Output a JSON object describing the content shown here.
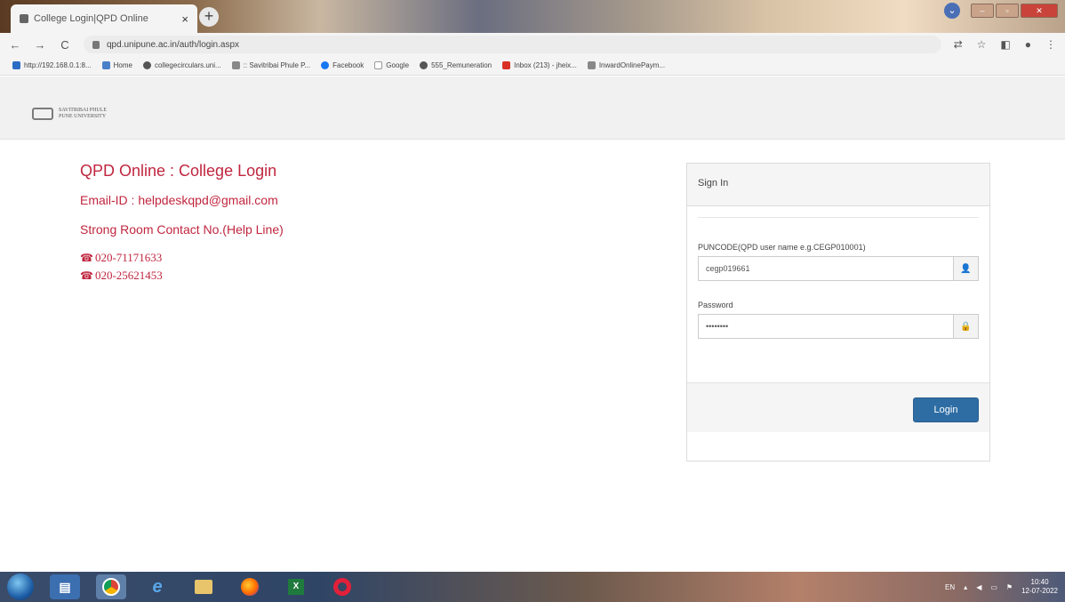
{
  "browser": {
    "tab_title": "College Login|QPD Online",
    "tab_close": "×",
    "new_tab": "+",
    "url": "qpd.unipune.ac.in/auth/login.aspx",
    "nav": {
      "back": "←",
      "forward": "→",
      "reload": "C"
    },
    "bookmarks": [
      {
        "label": "http://192.168.0.1:8...",
        "icon": "app-icon"
      },
      {
        "label": "Home",
        "icon": "home-icon"
      },
      {
        "label": "collegecirculars.uni...",
        "icon": "web-icon"
      },
      {
        "label": ":: Savitribai Phule P...",
        "icon": "university-icon"
      },
      {
        "label": "Facebook",
        "icon": "facebook-icon"
      },
      {
        "label": "Google",
        "icon": "google-icon"
      },
      {
        "label": "555_Remuneration",
        "icon": "web-icon"
      },
      {
        "label": "Inbox (213) - jheix...",
        "icon": "gmail-icon"
      },
      {
        "label": "InwardOnlinePaym...",
        "icon": "university-icon"
      }
    ]
  },
  "header": {
    "logo_line1": "SAVITRIBAI PHULE",
    "logo_line2": "PUNE UNIVERSITY"
  },
  "info": {
    "heading": "QPD Online : College Login",
    "email": "Email-ID : helpdeskqpd@gmail.com",
    "strong_room": "Strong Room Contact No.(Help Line)",
    "phones": [
      "020-71171633",
      "020-25621453"
    ]
  },
  "signin": {
    "title": "Sign In",
    "username_label": "PUNCODE(QPD user name e.g.CEGP010001)",
    "username_value": "cegp019661",
    "password_label": "Password",
    "password_value": "••••••••",
    "login_button": "Login"
  },
  "taskbar": {
    "language": "EN",
    "time": "10:40",
    "date": "12-07-2022"
  },
  "colors": {
    "accent_red": "#c0263f",
    "button_blue": "#2e6da4"
  }
}
